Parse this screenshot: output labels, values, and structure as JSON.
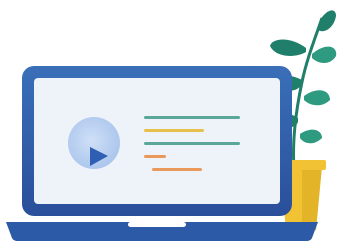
{
  "illustration": {
    "subject": "laptop-with-video-and-plant",
    "colors": {
      "laptop_body_top": "#3a6fb8",
      "laptop_body_bottom": "#2a4f9a",
      "screen": "#eef2f9",
      "base": "#2d5aa6",
      "play_circle": "#a9c4ec",
      "play_triangle": "#2f5fb3",
      "line_green": "#5aa79a",
      "line_yellow": "#e6c04a",
      "line_orange": "#e99a5b",
      "leaf_dark": "#1f7f6a",
      "leaf_light": "#2e9a80",
      "pot": "#f0c234",
      "pot_shade": "#d9a91f"
    },
    "icons": {
      "play": "play-icon"
    }
  }
}
